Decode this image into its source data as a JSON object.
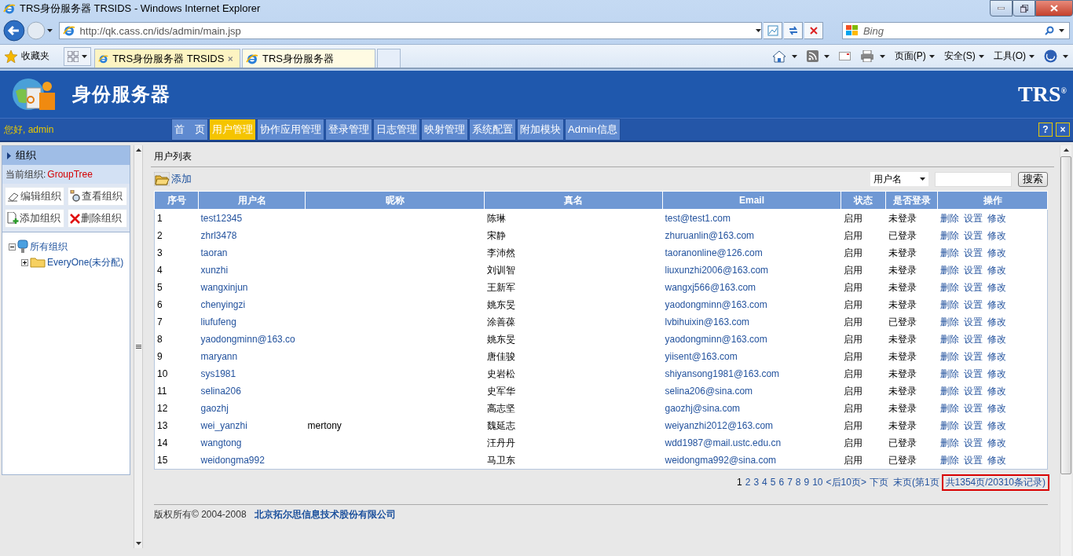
{
  "browser": {
    "title": "TRS身份服务器 TRSIDS - Windows Internet Explorer",
    "address": "http://qk.cass.cn/ids/admin/main.jsp",
    "search_placeholder": "Bing",
    "favorites": "收藏夹",
    "tabs": [
      {
        "label": "TRS身份服务器 TRSIDS",
        "selected": true
      },
      {
        "label": "TRS身份服务器",
        "selected": false
      }
    ],
    "commands": [
      "页面(P)",
      "安全(S)",
      "工具(O)"
    ]
  },
  "app": {
    "title": "身份服务器",
    "brand": "TRS$^{®}$",
    "greeting": "您好, admin",
    "nav": [
      {
        "label": "首　页",
        "selected": false
      },
      {
        "label": "用户管理",
        "selected": true
      },
      {
        "label": "协作应用管理",
        "selected": false
      },
      {
        "label": "登录管理",
        "selected": false
      },
      {
        "label": "日志管理",
        "selected": false
      },
      {
        "label": "映射管理",
        "selected": false
      },
      {
        "label": "系统配置",
        "selected": false
      },
      {
        "label": "附加模块",
        "selected": false
      },
      {
        "label": "Admin信息",
        "selected": false
      }
    ],
    "nav_buttons": [
      "?",
      "×"
    ]
  },
  "sidebar": {
    "header": "组织",
    "current_label": "当前组织:",
    "current_value": "GroupTree",
    "actions": [
      {
        "label": "编辑组织",
        "kind": "edit"
      },
      {
        "label": "查看组织",
        "kind": "view"
      },
      {
        "label": "添加组织",
        "kind": "add"
      },
      {
        "label": "删除组织",
        "kind": "delete"
      }
    ],
    "tree": [
      {
        "label": "所有组织",
        "expanded": true,
        "children": [
          {
            "label": "EveryOne(未分配)",
            "expanded": false
          }
        ]
      }
    ]
  },
  "main": {
    "title": "用户列表",
    "add": "添加",
    "search": {
      "field": "用户名",
      "button": "搜索"
    },
    "table": {
      "columns": [
        "序号",
        "用户名",
        "昵称",
        "真名",
        "Email",
        "状态",
        "是否登录",
        "操作"
      ],
      "rows": [
        {
          "no": "1",
          "username": "test12345",
          "nickname": "",
          "realname": "陈琳",
          "email": "test@test1.com",
          "status": "启用",
          "login": "未登录",
          "actions": [
            "删除",
            "设置",
            "修改"
          ]
        },
        {
          "no": "2",
          "username": "zhrl3478",
          "nickname": "",
          "realname": "宋静",
          "email": "zhuruanlin@163.com",
          "status": "启用",
          "login": "已登录",
          "actions": [
            "删除",
            "设置",
            "修改"
          ]
        },
        {
          "no": "3",
          "username": "taoran",
          "nickname": "",
          "realname": "李沛然",
          "email": "taoranonline@126.com",
          "status": "启用",
          "login": "未登录",
          "actions": [
            "删除",
            "设置",
            "修改"
          ]
        },
        {
          "no": "4",
          "username": "xunzhi",
          "nickname": "",
          "realname": "刘训智",
          "email": "liuxunzhi2006@163.com",
          "status": "启用",
          "login": "未登录",
          "actions": [
            "删除",
            "设置",
            "修改"
          ]
        },
        {
          "no": "5",
          "username": "wangxinjun",
          "nickname": "",
          "realname": "王新军",
          "email": "wangxj566@163.com",
          "status": "启用",
          "login": "未登录",
          "actions": [
            "删除",
            "设置",
            "修改"
          ]
        },
        {
          "no": "6",
          "username": "chenyingzi",
          "nickname": "",
          "realname": "姚东旻",
          "email": "yaodongminn@163.com",
          "status": "启用",
          "login": "未登录",
          "actions": [
            "删除",
            "设置",
            "修改"
          ]
        },
        {
          "no": "7",
          "username": "liufufeng",
          "nickname": "",
          "realname": "涂善葆",
          "email": "lvbihuixin@163.com",
          "status": "启用",
          "login": "已登录",
          "actions": [
            "删除",
            "设置",
            "修改"
          ]
        },
        {
          "no": "8",
          "username": "yaodongminn@163.co",
          "nickname": "",
          "realname": "姚东旻",
          "email": "yaodongminn@163.com",
          "status": "启用",
          "login": "未登录",
          "actions": [
            "删除",
            "设置",
            "修改"
          ]
        },
        {
          "no": "9",
          "username": "maryann",
          "nickname": "",
          "realname": "唐佳骏",
          "email": "yiisent@163.com",
          "status": "启用",
          "login": "未登录",
          "actions": [
            "删除",
            "设置",
            "修改"
          ]
        },
        {
          "no": "10",
          "username": "sys1981",
          "nickname": "",
          "realname": "史岩松",
          "email": "shiyansong1981@163.com",
          "status": "启用",
          "login": "未登录",
          "actions": [
            "删除",
            "设置",
            "修改"
          ]
        },
        {
          "no": "11",
          "username": "selina206",
          "nickname": "",
          "realname": "史军华",
          "email": "selina206@sina.com",
          "status": "启用",
          "login": "未登录",
          "actions": [
            "删除",
            "设置",
            "修改"
          ]
        },
        {
          "no": "12",
          "username": "gaozhj",
          "nickname": "",
          "realname": "高志坚",
          "email": "gaozhj@sina.com",
          "status": "启用",
          "login": "未登录",
          "actions": [
            "删除",
            "设置",
            "修改"
          ]
        },
        {
          "no": "13",
          "username": "wei_yanzhi",
          "nickname": "mertony",
          "realname": "魏延志",
          "email": "weiyanzhi2012@163.com",
          "status": "启用",
          "login": "未登录",
          "actions": [
            "删除",
            "设置",
            "修改"
          ]
        },
        {
          "no": "14",
          "username": "wangtong",
          "nickname": "",
          "realname": "汪丹丹",
          "email": "wdd1987@mail.ustc.edu.cn",
          "status": "启用",
          "login": "已登录",
          "actions": [
            "删除",
            "设置",
            "修改"
          ]
        },
        {
          "no": "15",
          "username": "weidongma992",
          "nickname": "",
          "realname": "马卫东",
          "email": "weidongma992@sina.com",
          "status": "启用",
          "login": "已登录",
          "actions": [
            "删除",
            "设置",
            "修改"
          ]
        }
      ]
    },
    "pagination": {
      "pages": [
        {
          "label": "1",
          "selected": true
        },
        {
          "label": "2",
          "selected": false
        },
        {
          "label": "3",
          "selected": false
        },
        {
          "label": "4",
          "selected": false
        },
        {
          "label": "5",
          "selected": false
        },
        {
          "label": "6",
          "selected": false
        },
        {
          "label": "7",
          "selected": false
        },
        {
          "label": "8",
          "selected": false
        },
        {
          "label": "9",
          "selected": false
        },
        {
          "label": "10",
          "selected": false
        }
      ],
      "next10": "<后10页>",
      "next": "下页",
      "last": "末页",
      "current": "(第1页",
      "total": "共1354页/20310条记录)"
    },
    "footer": {
      "copyright": "版权所有© 2004-2008",
      "company": "北京拓尔思信息技术股份有限公司"
    }
  }
}
